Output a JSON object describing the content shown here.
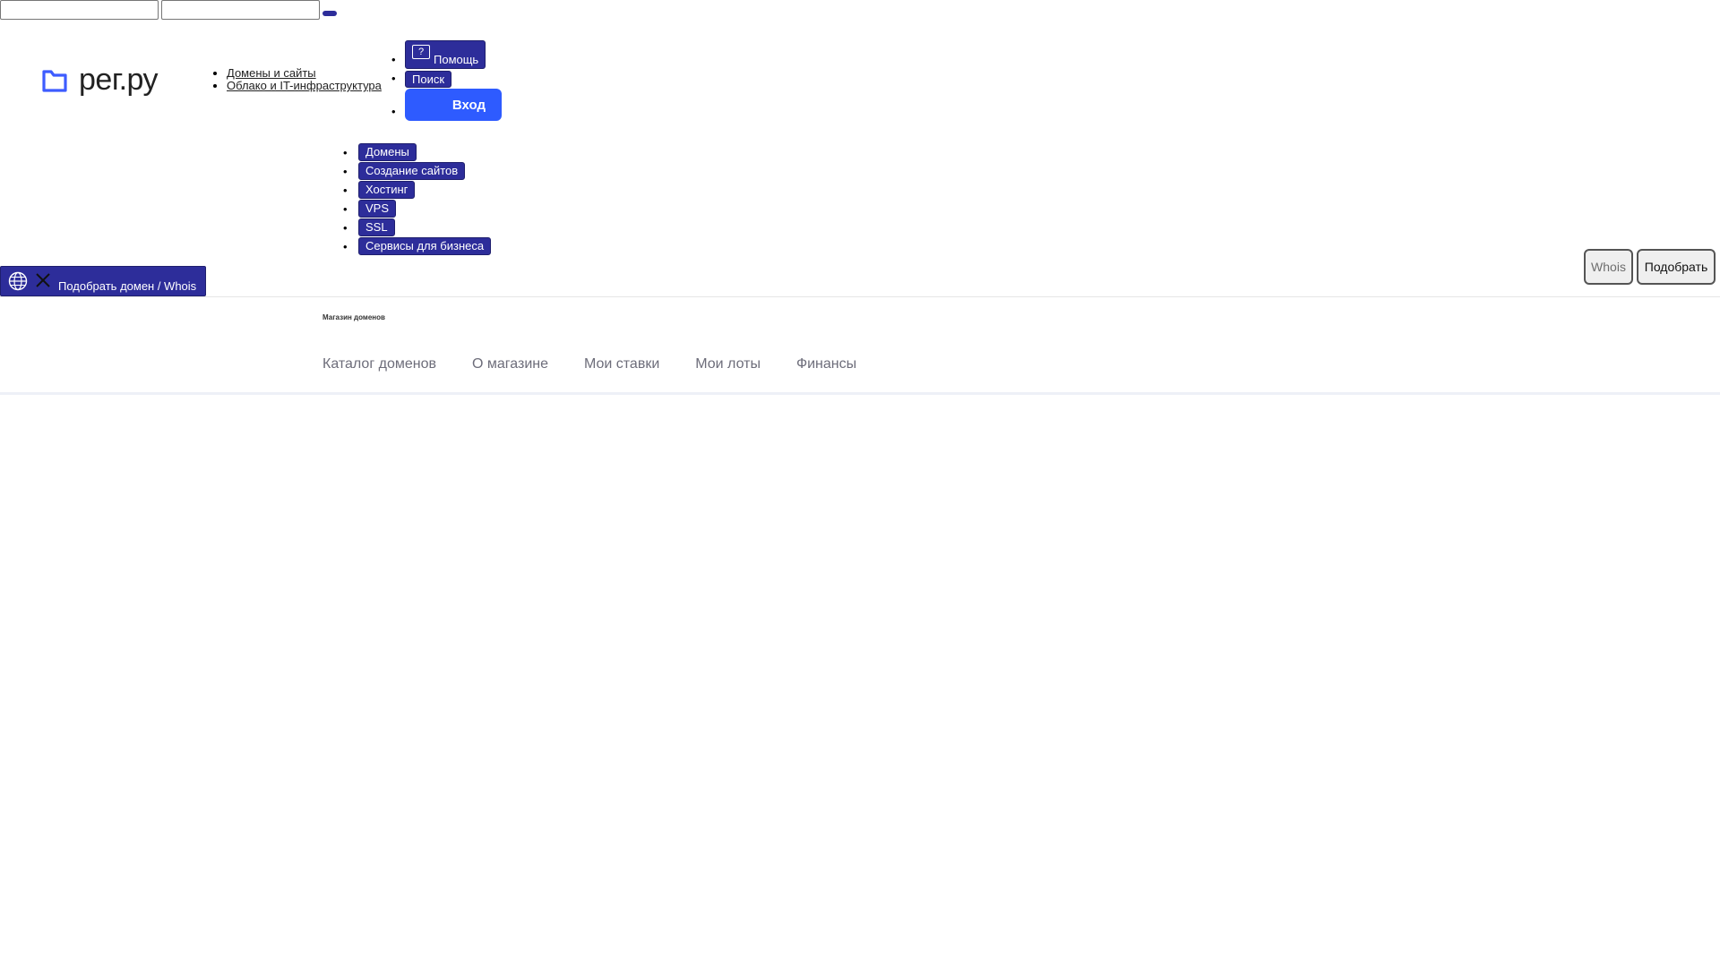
{
  "top_form": {
    "input1_value": "",
    "input2_value": ""
  },
  "logo": {
    "text": "рег.ру",
    "icon": "folder-icon",
    "color": "#3d5cff"
  },
  "mini_links": [
    {
      "label": "Домены и сайты"
    },
    {
      "label": "Облако и IT-инфраструктура"
    }
  ],
  "header_actions": {
    "help_label": "Помощь",
    "help_icon": "question-icon",
    "search_label": "Поиск",
    "login_label": "Вход"
  },
  "main_menu": [
    {
      "label": "Домены"
    },
    {
      "label": "Создание сайтов"
    },
    {
      "label": "Хостинг"
    },
    {
      "label": "VPS"
    },
    {
      "label": "SSL"
    },
    {
      "label": "Сервисы для бизнеса"
    }
  ],
  "domain_search": {
    "toggle_label": "Подобрать домен / Whois",
    "globe_icon": "globe-icon",
    "close_icon": "close-icon",
    "whois_label": "Whois",
    "pick_label": "Подобрать"
  },
  "shop": {
    "title": "Магазин доменов",
    "tabs": [
      {
        "label": "Каталог доменов"
      },
      {
        "label": "О магазине"
      },
      {
        "label": "Мои ставки"
      },
      {
        "label": "Мои лоты"
      },
      {
        "label": "Финансы"
      }
    ]
  },
  "colors": {
    "button_dark": "#2d2d9a",
    "login_blue": "#2e5bff",
    "tab_text": "#6d6d7a"
  }
}
